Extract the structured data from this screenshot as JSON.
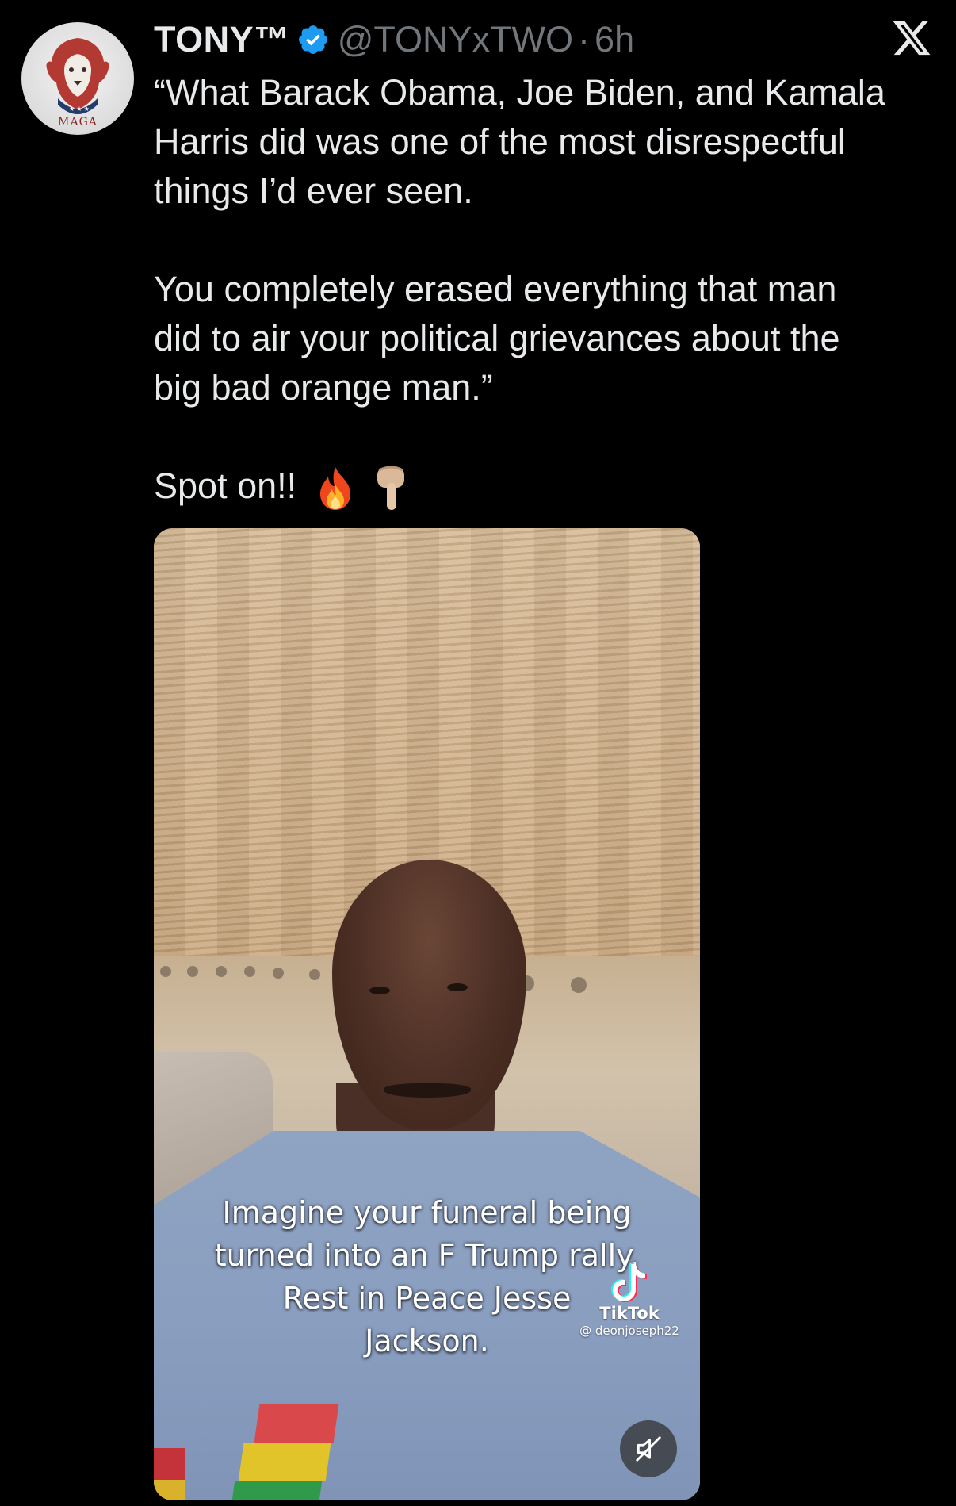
{
  "tweet": {
    "display_name": "TONY™",
    "handle": "@TONYxTWO",
    "separator": "·",
    "time": "6h",
    "avatar_text": "MAGA",
    "body": {
      "line1": "“What Barack Obama, Joe Biden, and Kamala",
      "line2": "Harris did was one of the most disrespectful",
      "line3": "things I’d ever seen.",
      "line4": "You completely erased everything that man",
      "line5": "did to air your political grievances about the",
      "line6": "big bad orange man.”",
      "line7": "Spot on!!"
    },
    "emojis": [
      "fire-emoji",
      "pointing-down-emoji"
    ]
  },
  "media": {
    "caption": {
      "line1": "Imagine your funeral being",
      "line2": "turned into an F Trump rally.",
      "line3": "Rest in Peace Jesse",
      "line4": "Jackson."
    },
    "watermark": {
      "brand": "TikTok",
      "user": "@ deonjoseph22"
    },
    "controls": {
      "mute_icon": "speaker-muted-icon"
    }
  },
  "colors": {
    "background": "#000000",
    "text_primary": "#e7e9ea",
    "text_secondary": "#71767b",
    "verified_blue": "#1d9bf0"
  }
}
